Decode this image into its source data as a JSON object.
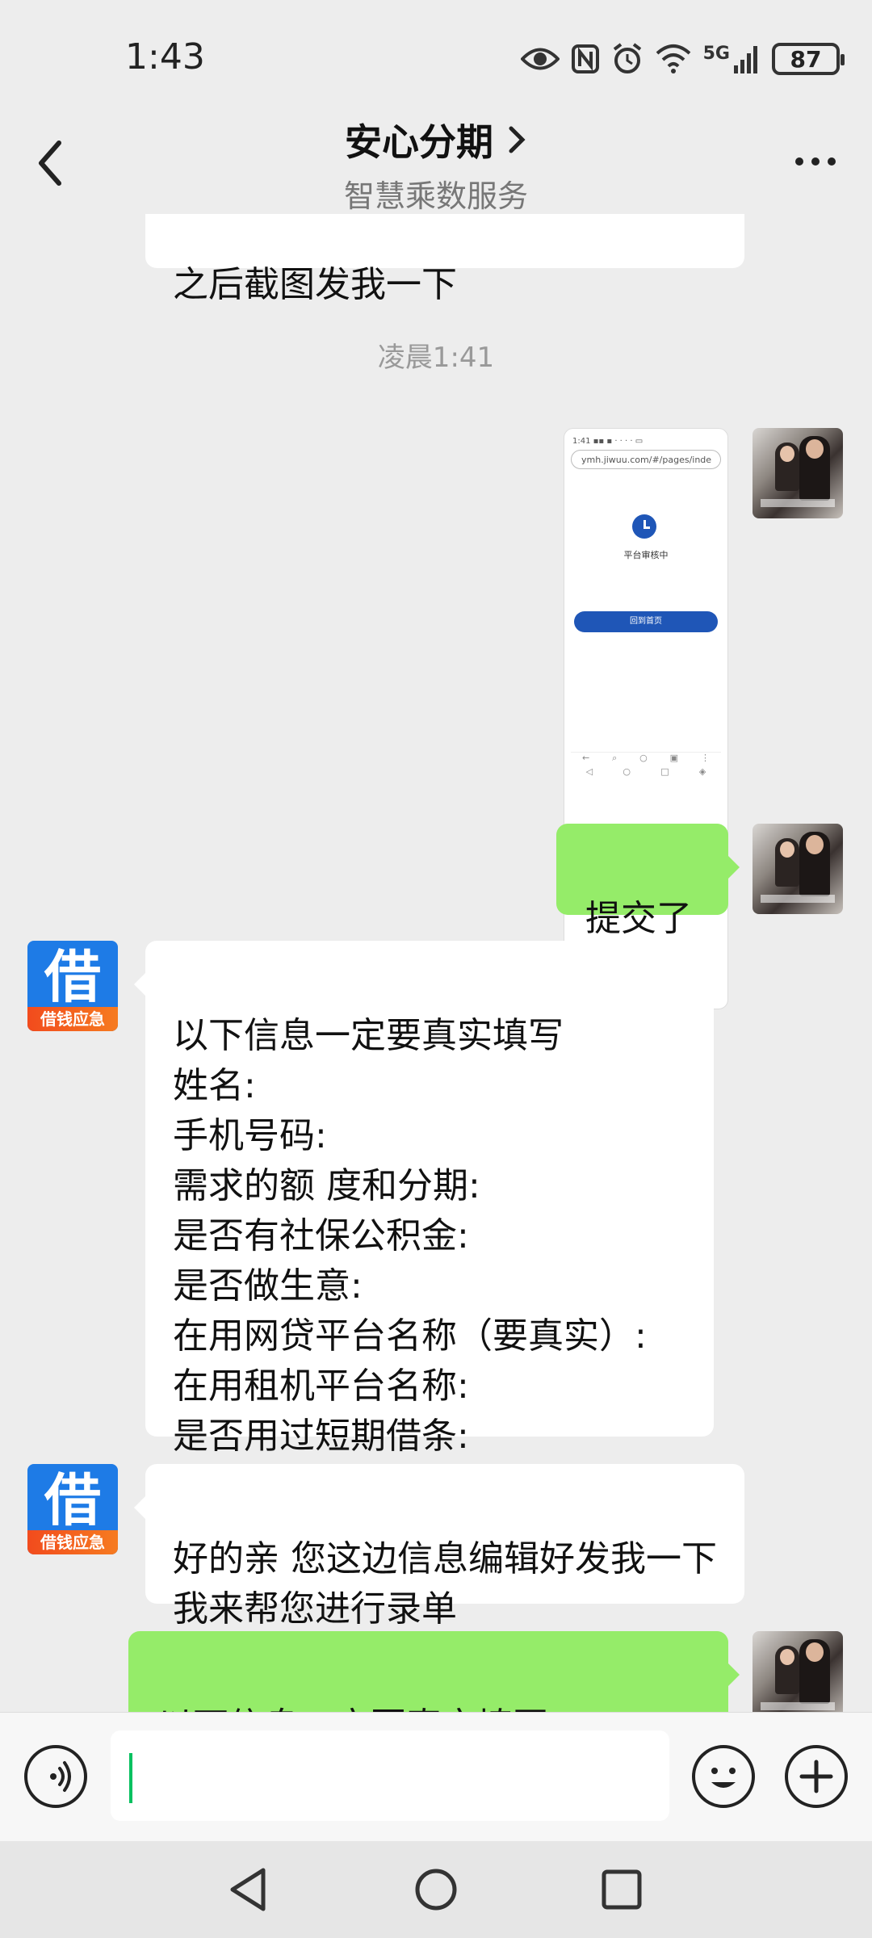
{
  "status_bar": {
    "time": "1:43",
    "network": "5G",
    "battery": "87",
    "icons": [
      "eye-icon",
      "nfc-icon",
      "alarm-icon",
      "wifi-icon",
      "signal-icon",
      "battery-icon"
    ]
  },
  "header": {
    "title": "安心分期",
    "subtitle": "智慧乘数服务"
  },
  "messages": [
    {
      "side": "left",
      "type": "text",
      "text": "之后截图发我一下"
    },
    {
      "type": "timestamp",
      "text": "凌晨1:41"
    },
    {
      "side": "right",
      "type": "image",
      "image": {
        "url_text": "ymh.jiwuu.com/#/pages/inde",
        "status_text": "平台审核中",
        "button_text": "回到首页"
      }
    },
    {
      "side": "right",
      "type": "text",
      "text": "提交了"
    },
    {
      "side": "left",
      "type": "text",
      "text": "以下信息一定要真实填写\n姓名:\n手机号码:\n需求的额 度和分期:\n是否有社保公积金:\n是否做生意:\n在用网贷平台名称（要真实）:\n在用租机平台名称:\n是否用过短期借条:"
    },
    {
      "side": "left",
      "type": "text",
      "text": "好的亲 您这边信息编辑好发我一下 我来帮您进行录单"
    },
    {
      "side": "right",
      "type": "text",
      "text": "以下信息一定要真实填写\n姓名:"
    }
  ],
  "bot_avatar": {
    "char": "借",
    "band": "借钱应急"
  },
  "input": {
    "value": ""
  },
  "colors": {
    "background": "#ededed",
    "self_bubble": "#95ec69",
    "other_bubble": "#ffffff",
    "cursor": "#07c160",
    "bot_avatar": "#1e7be6"
  }
}
